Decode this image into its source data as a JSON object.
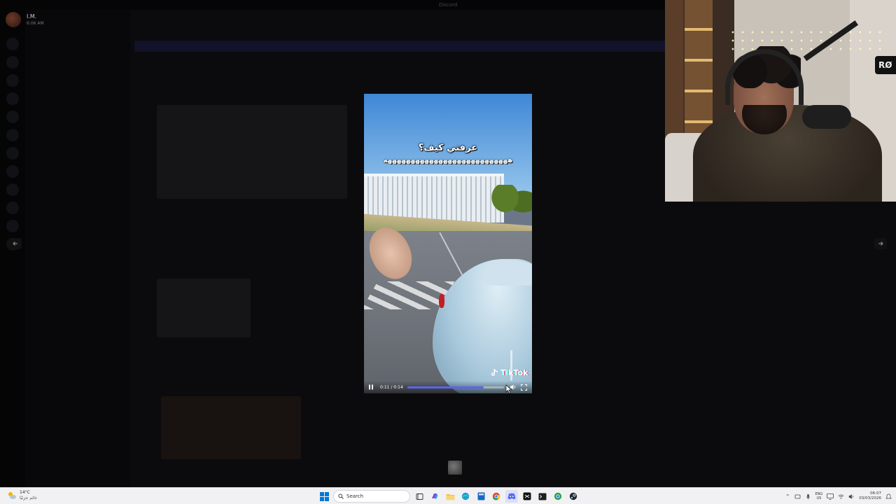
{
  "app": {
    "window_title": "Discord",
    "user": {
      "name": "I.M.",
      "time": "6:06 AM"
    },
    "banner_text": ""
  },
  "video": {
    "caption_line1": "عرفتي كيف؟",
    "caption_line2": "هههههههههههههههههههههههههههه",
    "watermark": "TikTok",
    "time_readout": "0:11 / 0:14",
    "progress": 0.79,
    "icons": {
      "play_pause": "pause-icon",
      "volume": "volume-icon",
      "fullscreen": "fullscreen-icon"
    }
  },
  "navigation": {
    "prev_icon": "arrow-left-icon",
    "next_icon": "arrow-right-icon"
  },
  "webcam": {
    "brand_tag": "RØ"
  },
  "taskbar": {
    "weather": {
      "temp": "14°C",
      "desc": "غائم جزئيًا"
    },
    "search_placeholder": "Search",
    "language": {
      "lang": "ENG",
      "region": "US"
    },
    "clock": {
      "time": "06:07",
      "date": "03/03/2026"
    },
    "colors": {
      "accent": "#5865f2",
      "win_blue": "#0078d4"
    }
  }
}
